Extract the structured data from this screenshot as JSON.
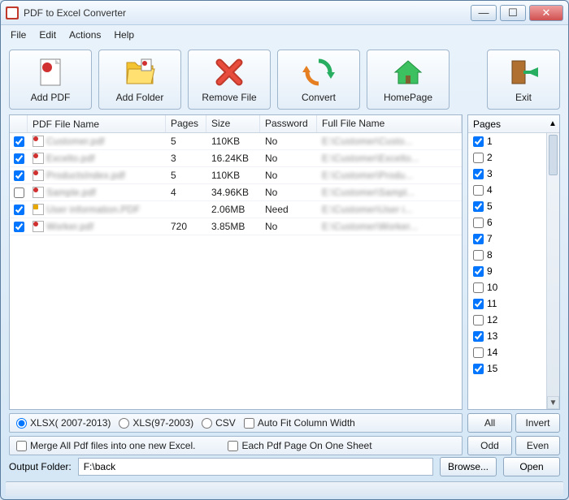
{
  "window": {
    "title": "PDF to Excel Converter"
  },
  "menu": {
    "file": "File",
    "edit": "Edit",
    "actions": "Actions",
    "help": "Help"
  },
  "toolbar": {
    "add_pdf": "Add PDF",
    "add_folder": "Add Folder",
    "remove_file": "Remove File",
    "convert": "Convert",
    "homepage": "HomePage",
    "exit": "Exit"
  },
  "columns": {
    "name": "PDF File Name",
    "pages": "Pages",
    "size": "Size",
    "password": "Password",
    "full": "Full File Name"
  },
  "files": [
    {
      "checked": true,
      "locked": false,
      "name": "Customer.pdf",
      "pages": "5",
      "size": "110KB",
      "password": "No",
      "full": "E:\\Customer\\Custo..."
    },
    {
      "checked": true,
      "locked": false,
      "name": "Excelto.pdf",
      "pages": "3",
      "size": "16.24KB",
      "password": "No",
      "full": "E:\\Customer\\Excelto..."
    },
    {
      "checked": true,
      "locked": false,
      "name": "ProductsIndex.pdf",
      "pages": "5",
      "size": "110KB",
      "password": "No",
      "full": "E:\\Customer\\Produ..."
    },
    {
      "checked": false,
      "locked": false,
      "name": "Sample.pdf",
      "pages": "4",
      "size": "34.96KB",
      "password": "No",
      "full": "E:\\Customer\\Sampl..."
    },
    {
      "checked": true,
      "locked": true,
      "name": "User information.PDF",
      "pages": "",
      "size": "2.06MB",
      "password": "Need",
      "full": "E:\\Customer\\User i..."
    },
    {
      "checked": true,
      "locked": false,
      "name": "Worker.pdf",
      "pages": "720",
      "size": "3.85MB",
      "password": "No",
      "full": "E:\\Customer\\Worker..."
    }
  ],
  "pages_panel": {
    "header": "Pages",
    "items": [
      {
        "n": "1",
        "checked": true
      },
      {
        "n": "2",
        "checked": false
      },
      {
        "n": "3",
        "checked": true
      },
      {
        "n": "4",
        "checked": false
      },
      {
        "n": "5",
        "checked": true
      },
      {
        "n": "6",
        "checked": false
      },
      {
        "n": "7",
        "checked": true
      },
      {
        "n": "8",
        "checked": false
      },
      {
        "n": "9",
        "checked": true
      },
      {
        "n": "10",
        "checked": false
      },
      {
        "n": "11",
        "checked": true
      },
      {
        "n": "12",
        "checked": false
      },
      {
        "n": "13",
        "checked": true
      },
      {
        "n": "14",
        "checked": false
      },
      {
        "n": "15",
        "checked": true
      }
    ]
  },
  "format": {
    "xlsx": "XLSX( 2007-2013)",
    "xls": "XLS(97-2003)",
    "csv": "CSV",
    "autofit": "Auto Fit Column Width",
    "merge": "Merge All Pdf files into one new Excel.",
    "each": "Each Pdf Page On One Sheet"
  },
  "page_buttons": {
    "all": "All",
    "invert": "Invert",
    "odd": "Odd",
    "even": "Even"
  },
  "output": {
    "label": "Output Folder:",
    "path": "F:\\back",
    "browse": "Browse...",
    "open": "Open"
  }
}
